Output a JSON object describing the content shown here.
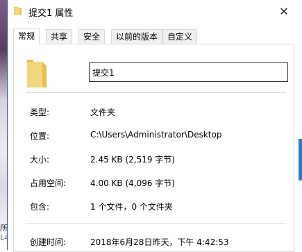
{
  "window": {
    "title": "提交1 属性",
    "close_glyph": "✕"
  },
  "tabs": [
    {
      "label": "常规",
      "active": true
    },
    {
      "label": "共享",
      "active": false
    },
    {
      "label": "安全",
      "active": false
    },
    {
      "label": "以前的版本",
      "active": false
    },
    {
      "label": "自定义",
      "active": false
    }
  ],
  "general": {
    "name_value": "提交1",
    "rows": [
      {
        "label": "类型:",
        "value": "文件夹"
      },
      {
        "label": "位置:",
        "value": "C:\\Users\\Administrator\\Desktop"
      },
      {
        "label": "大小:",
        "value": "2.45 KB (2,519 字节)"
      },
      {
        "label": "占用空间:",
        "value": "4.00 KB (4,096 字节)"
      },
      {
        "label": "包含:",
        "value": "1 个文件，0 个文件夹"
      },
      {
        "label": "创建时间:",
        "value": "2018年6月28日昨天，下午 4:42:53"
      }
    ]
  },
  "background_fragments": {
    "text1": "所",
    "text2": "L4"
  },
  "colors": {
    "folder_fill": "#f5d67e",
    "folder_shade": "#e8bd4a",
    "border": "#d9d9d9"
  },
  "icons": {
    "title_icon": "folder-icon",
    "big_icon": "folder-icon",
    "close": "close-icon"
  }
}
